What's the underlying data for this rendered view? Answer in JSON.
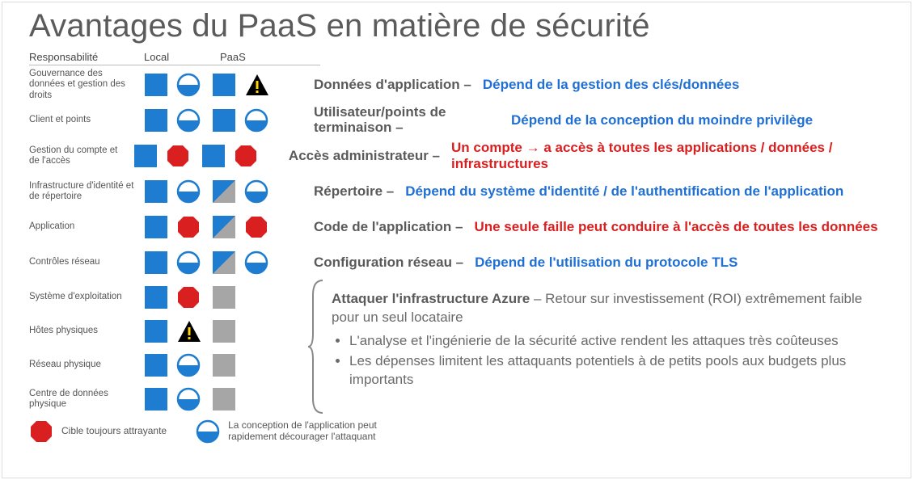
{
  "title": "Avantages du PaaS en matière de sécurité",
  "headers": {
    "responsibility": "Responsabilité",
    "local": "Local",
    "paas": "PaaS"
  },
  "rows": [
    {
      "label": "Gouvernance des données et gestion des droits",
      "icons_local": [
        "square-blue",
        "half-circle"
      ],
      "icons_paas": [
        "square-blue",
        "warn-tri"
      ],
      "name": "Données d'application –",
      "desc": "Dépend de la gestion des clés/données",
      "desc_style": "blue"
    },
    {
      "label": "Client et points",
      "icons_local": [
        "square-blue",
        "half-circle"
      ],
      "icons_paas": [
        "square-blue",
        "half-circle"
      ],
      "name": "Utilisateur/points de terminaison –",
      "name_two": true,
      "desc": "Dépend de la conception du moindre privilège",
      "desc_style": "blue"
    },
    {
      "label": "Gestion du compte et de l'accès",
      "icons_local": [
        "square-blue",
        "octagon"
      ],
      "icons_paas": [
        "square-blue",
        "octagon"
      ],
      "name": "Accès administrateur –",
      "desc_compound": {
        "pre": "Un compte ",
        "arrow": "→ ",
        "post": "a accès à toutes les applications / données / infrastructures"
      },
      "desc_style": "red"
    },
    {
      "label": "Infrastructure d'identité et de répertoire",
      "icons_local": [
        "square-blue",
        "half-circle"
      ],
      "icons_paas": [
        "tri-bluegray",
        "half-circle"
      ],
      "name": "Répertoire –",
      "desc": "Dépend du système d'identité / de l'authentification de l'application",
      "desc_style": "blue"
    },
    {
      "label": "Application",
      "icons_local": [
        "square-blue",
        "octagon"
      ],
      "icons_paas": [
        "tri-bluegray",
        "octagon"
      ],
      "name": "Code de l'application –",
      "desc": "Une seule faille peut conduire à l'accès de toutes les données",
      "desc_style": "red"
    },
    {
      "label": "Contrôles réseau",
      "icons_local": [
        "square-blue",
        "half-circle"
      ],
      "icons_paas": [
        "tri-bluegray",
        "half-circle"
      ],
      "name": "Configuration réseau –",
      "desc": "Dépend de l'utilisation du protocole TLS",
      "desc_style": "blue"
    }
  ],
  "lower_rows": [
    {
      "label": "Système d'exploitation",
      "icons_local": [
        "square-blue",
        "octagon"
      ],
      "icons_paas": [
        "square-gray",
        ""
      ]
    },
    {
      "label": "Hôtes physiques",
      "icons_local": [
        "square-blue",
        "warn-tri"
      ],
      "icons_paas": [
        "square-gray",
        ""
      ]
    },
    {
      "label": "Réseau physique",
      "icons_local": [
        "square-blue",
        "half-circle"
      ],
      "icons_paas": [
        "square-gray",
        ""
      ]
    },
    {
      "label": "Centre de données physique",
      "icons_local": [
        "square-blue",
        "half-circle"
      ],
      "icons_paas": [
        "square-gray",
        ""
      ]
    }
  ],
  "azure": {
    "lead": "Attaquer l'infrastructure Azure",
    "lead_rest": " – Retour sur investissement (ROI) extrêmement faible pour un seul locataire",
    "bullets": [
      "L'analyse et l'ingénierie de la sécurité active rendent les attaques très coûteuses",
      "Les dépenses limitent les attaquants potentiels à de petits pools aux budgets plus importants"
    ]
  },
  "legend": {
    "octagon": "Cible toujours attrayante",
    "half": "La conception de l'application peut rapidement décourager l'attaquant"
  }
}
